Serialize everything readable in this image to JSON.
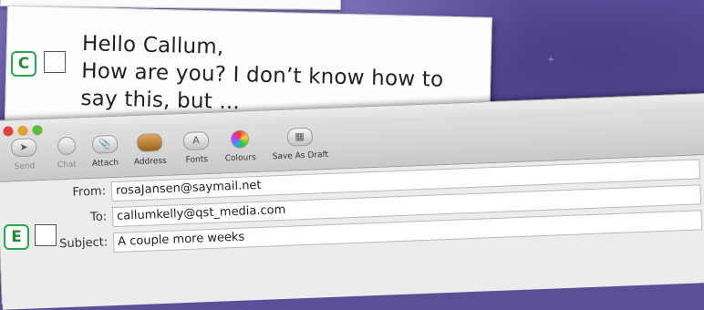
{
  "option_c": {
    "letter": "C",
    "message_lines": [
      "Hello Callum,",
      "How are you? I don’t know how to",
      "say this, but ..."
    ]
  },
  "option_e": {
    "letter": "E"
  },
  "mail_window": {
    "toolbar": [
      {
        "name": "send",
        "label": "Send",
        "icon": "paper-plane-icon",
        "enabled": false
      },
      {
        "name": "chat",
        "label": "Chat",
        "icon": "chat-bubble-icon",
        "enabled": false
      },
      {
        "name": "attach",
        "label": "Attach",
        "icon": "paperclip-icon",
        "enabled": true
      },
      {
        "name": "address",
        "label": "Address",
        "icon": "address-book-icon",
        "enabled": true
      },
      {
        "name": "fonts",
        "label": "Fonts",
        "icon": "font-icon",
        "enabled": true
      },
      {
        "name": "colours",
        "label": "Colours",
        "icon": "colour-wheel-icon",
        "enabled": true
      },
      {
        "name": "save-as-draft",
        "label": "Save As Draft",
        "icon": "draft-icon",
        "enabled": true
      }
    ],
    "fields": {
      "from_label": "From:",
      "from_value": "rosaJansen@saymail.net",
      "to_label": "To:",
      "to_value": "callumkelly@qst_media.com",
      "subject_label": "Subject:",
      "subject_value": "A couple more weeks"
    },
    "traffic_light_colors": [
      "#e0443e",
      "#e1a32c",
      "#5bbd3b"
    ]
  }
}
